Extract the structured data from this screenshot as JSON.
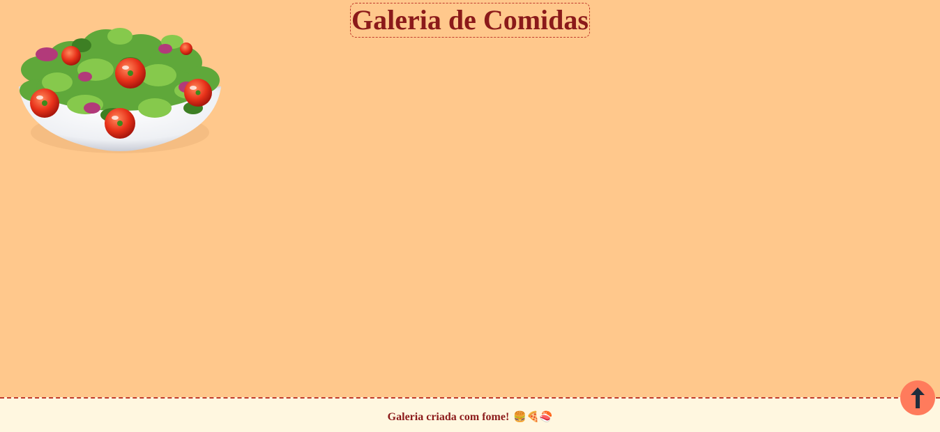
{
  "header": {
    "title": "Galeria de Comidas"
  },
  "gallery": {
    "items": [
      {
        "name": "salad",
        "icon": "salad-bowl-image"
      }
    ]
  },
  "footer": {
    "text": "Galeria criada com fome!",
    "emojis": "🍔🍕🍣"
  },
  "back_to_top": {
    "icon": "arrow-up-icon"
  },
  "colors": {
    "background": "#ffc88c",
    "title": "#8b1a1a",
    "footer_background": "#fff7e0",
    "accent_border": "#c0392b",
    "button": "#ff7b5c",
    "arrow": "#1f2d3d"
  }
}
